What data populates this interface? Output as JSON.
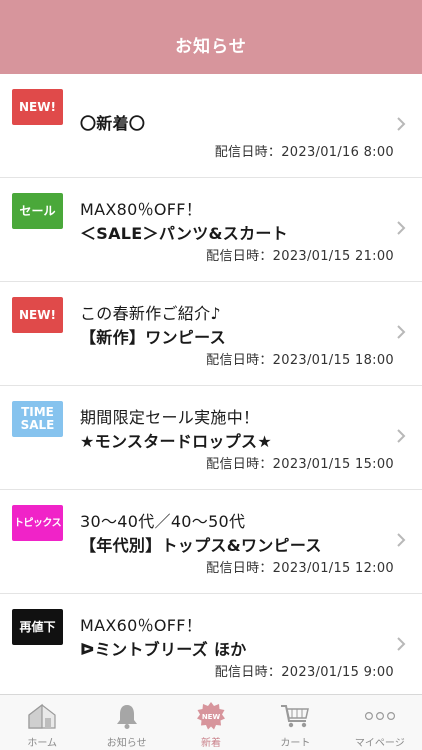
{
  "header": {
    "title": "お知らせ"
  },
  "news": [
    {
      "badge": "NEW!",
      "badge_color": "#e04a4a",
      "line1": "",
      "line2": "〇新着〇",
      "date": "配信日時：2023/01/16 8:00"
    },
    {
      "badge": "セール",
      "badge_color": "#4aa83a",
      "line1": "MAX80％OFF！",
      "line2": "＜SALE＞パンツ&スカート",
      "date": "配信日時：2023/01/15 21:00"
    },
    {
      "badge": "NEW!",
      "badge_color": "#e04a4a",
      "line1": "この春新作ご紹介♪",
      "line2": "【新作】ワンピース",
      "date": "配信日時：2023/01/15 18:00"
    },
    {
      "badge": "TIME SALE",
      "badge_color": "#86c3ee",
      "line1": "期間限定セール実施中！",
      "line2": "★モンスタードロップス★",
      "date": "配信日時：2023/01/15 15:00"
    },
    {
      "badge": "トピックス",
      "badge_color": "#f023c8",
      "line1": "30～40代／40～50代",
      "line2": "【年代別】トップス&ワンピース",
      "date": "配信日時：2023/01/15 12:00"
    },
    {
      "badge": "再値下",
      "badge_color": "#111111",
      "line1": "MAX60％OFF！",
      "line2": "ᐅミントブリーズ ほか",
      "date": "配信日時：2023/01/15 9:00"
    }
  ],
  "tabs": [
    {
      "label": "ホーム",
      "icon": "home-icon"
    },
    {
      "label": "お知らせ",
      "icon": "bell-icon"
    },
    {
      "label": "新着",
      "icon": "new-badge-icon",
      "icon_text": "NEW",
      "active": true
    },
    {
      "label": "カート",
      "icon": "cart-icon"
    },
    {
      "label": "マイページ",
      "icon": "more-dots-icon"
    }
  ],
  "colors": {
    "header": "#d7959c",
    "active_tab": "#c9818a"
  }
}
